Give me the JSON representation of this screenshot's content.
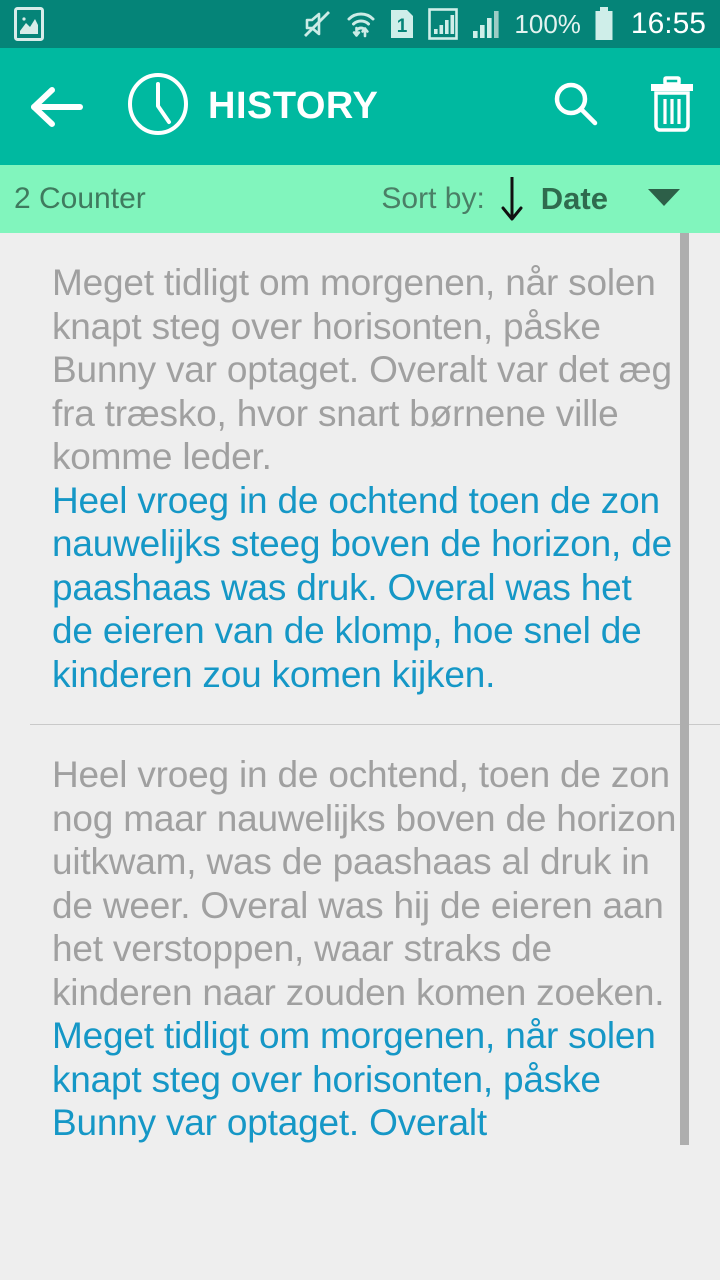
{
  "status_bar": {
    "icons": [
      {
        "name": "gallery-icon",
        "label": "Gallery"
      },
      {
        "name": "mute-icon",
        "label": "Sound muted"
      },
      {
        "name": "wifi-icon",
        "label": "Wi-Fi"
      },
      {
        "name": "sim-icon",
        "label": "1"
      },
      {
        "name": "signal-icon-1",
        "label": "Signal 1"
      },
      {
        "name": "signal-icon-2",
        "label": "Signal 2"
      }
    ],
    "sim_number": "1",
    "battery_percent": "100%",
    "clock": "16:55"
  },
  "action_bar": {
    "back_label": "Back",
    "title": "HISTORY",
    "clock_icon": "clock-icon",
    "search_label": "Search",
    "delete_label": "Delete"
  },
  "sort_bar": {
    "counter": "2 Counter",
    "sort_label": "Sort by:",
    "sort_direction": "descending",
    "sort_value": "Date",
    "caret": "dropdown-caret"
  },
  "history": {
    "items": [
      {
        "source_text": "Meget tidligt om morgenen, når solen knapt steg over horisonten, påske Bunny var optaget. Overalt var det æg fra træsko, hvor snart børnene ville komme leder.",
        "target_text": "Heel vroeg in de ochtend toen de zon nauwelijks steeg boven de horizon, de paashaas was druk. Overal was het de eieren van de klomp, hoe snel de kinderen zou komen kijken."
      },
      {
        "source_text": "Heel vroeg in de ochtend, toen de zon nog maar nauwelijks boven de horizon uitkwam, was de paashaas al druk in de weer. Overal was hij de eieren aan het verstoppen, waar straks de kinderen naar zouden komen zoeken.",
        "target_text": "Meget tidligt om morgenen, når solen knapt steg over horisonten, påske Bunny var optaget. Overalt"
      }
    ]
  },
  "colors": {
    "status_bar_bg": "#058478",
    "action_bar_bg": "#00b9a0",
    "sort_bar_bg": "#81f5bd",
    "content_bg": "#eeeeee",
    "source_text": "#a0a0a0",
    "target_text": "#1597c6",
    "scrollbar": "#aeaeae"
  }
}
